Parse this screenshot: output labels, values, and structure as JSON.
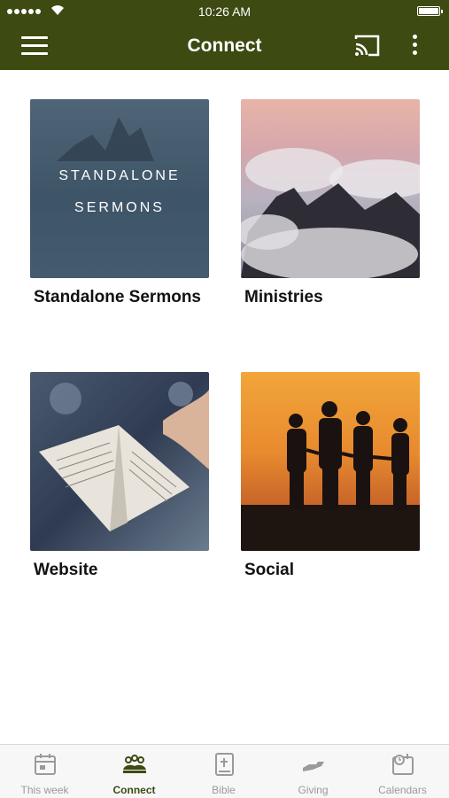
{
  "status_bar": {
    "time": "10:26 AM"
  },
  "header": {
    "title": "Connect"
  },
  "tiles": [
    {
      "label": "Standalone Sermons",
      "overlay_line1": "STANDALONE",
      "overlay_line2": "SERMONS"
    },
    {
      "label": "Ministries"
    },
    {
      "label": "Website"
    },
    {
      "label": "Social"
    }
  ],
  "tabs": [
    {
      "label": "This week",
      "icon": "calendar-icon"
    },
    {
      "label": "Connect",
      "icon": "people-icon",
      "active": true
    },
    {
      "label": "Bible",
      "icon": "bible-icon"
    },
    {
      "label": "Giving",
      "icon": "giving-hand-icon"
    },
    {
      "label": "Calendars",
      "icon": "calendar-clock-icon"
    }
  ],
  "colors": {
    "brand": "#3d4a12",
    "tab_inactive": "#9a9a9a"
  }
}
